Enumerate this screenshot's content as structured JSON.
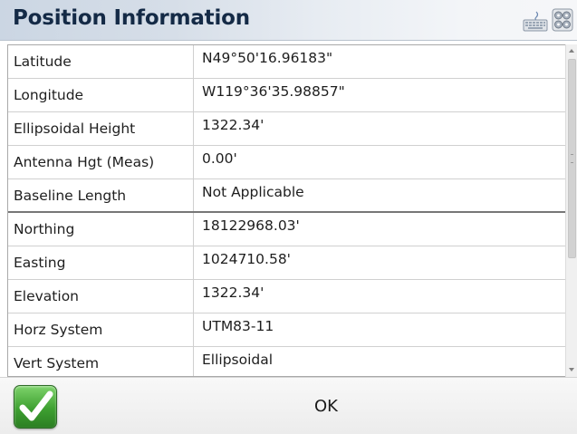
{
  "header": {
    "title": "Position Information",
    "icons": [
      "keyboard-icon",
      "settings-icon"
    ]
  },
  "position_table": {
    "rows": [
      {
        "label": "Latitude",
        "value": "N49°50'16.96183\""
      },
      {
        "label": "Longitude",
        "value": "W119°36'35.98857\""
      },
      {
        "label": "Ellipsoidal Height",
        "value": "1322.34'"
      },
      {
        "label": "Antenna Hgt (Meas)",
        "value": "0.00'"
      },
      {
        "label": "Baseline Length",
        "value": "Not Applicable"
      },
      {
        "label": "Northing",
        "value": "18122968.03'"
      },
      {
        "label": "Easting",
        "value": "1024710.58'"
      },
      {
        "label": "Elevation",
        "value": "1322.34'"
      },
      {
        "label": "Horz System",
        "value": "UTM83-11"
      },
      {
        "label": "Vert System",
        "value": "Ellipsoidal"
      }
    ]
  },
  "footer": {
    "accept_icon": "checkmark-icon",
    "ok_label": "OK"
  },
  "colors": {
    "title_text": "#142a46",
    "accept_green": "#3ea031"
  }
}
